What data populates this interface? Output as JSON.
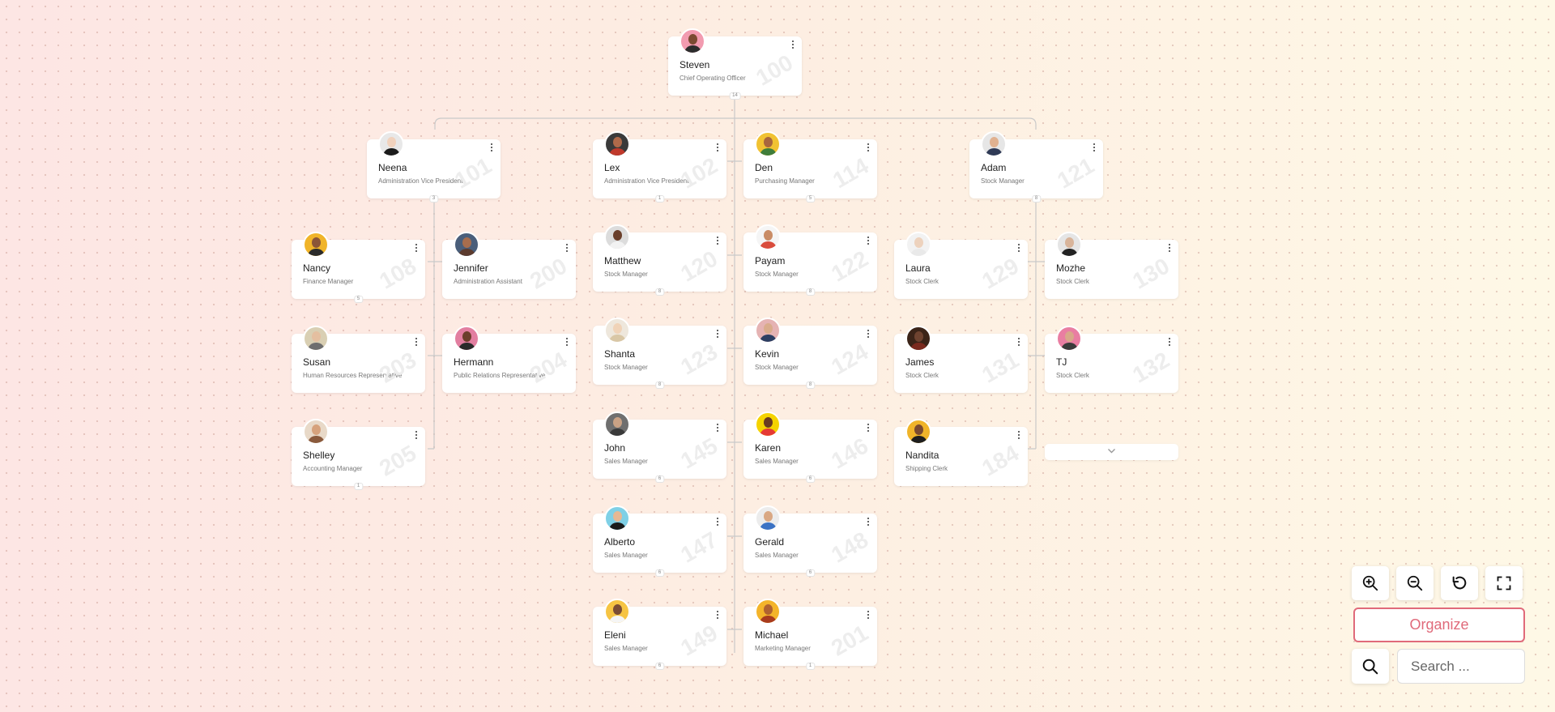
{
  "employees": [
    {
      "key": "steven",
      "name": "Steven",
      "title": "Chief Operating Officer",
      "id": "100",
      "badge": "14",
      "skin": "#7b4a32",
      "shirt": "#2c2c2c",
      "bg": "#f29bb0"
    },
    {
      "key": "neena",
      "name": "Neena",
      "title": "Administration Vice President",
      "id": "101",
      "badge": "3",
      "skin": "#f1d2bd",
      "shirt": "#1b1b1b",
      "bg": "#e8e8e8"
    },
    {
      "key": "lex",
      "name": "Lex",
      "title": "Administration Vice President",
      "id": "102",
      "badge": "1",
      "skin": "#b06a4a",
      "shirt": "#c0392b",
      "bg": "#3a3a3a"
    },
    {
      "key": "den",
      "name": "Den",
      "title": "Purchasing Manager",
      "id": "114",
      "badge": "5",
      "skin": "#a8663e",
      "shirt": "#3f7d3a",
      "bg": "#f1c232"
    },
    {
      "key": "adam",
      "name": "Adam",
      "title": "Stock Manager",
      "id": "121",
      "badge": "8",
      "skin": "#e0b190",
      "shirt": "#2f3a56",
      "bg": "#e6e6e6"
    },
    {
      "key": "nancy",
      "name": "Nancy",
      "title": "Finance Manager",
      "id": "108",
      "badge": "5",
      "skin": "#8a5538",
      "shirt": "#2b2b2b",
      "bg": "#f0b429"
    },
    {
      "key": "jennifer",
      "name": "Jennifer",
      "title": "Administration Assistant",
      "id": "200",
      "badge": "",
      "skin": "#a86d4d",
      "shirt": "#5c3b2e",
      "bg": "#4a5e7a"
    },
    {
      "key": "susan",
      "name": "Susan",
      "title": "Human Resources Representative",
      "id": "203",
      "badge": "",
      "skin": "#e4bfa0",
      "shirt": "#6e6e6e",
      "bg": "#d9cfb3"
    },
    {
      "key": "hermann",
      "name": "Hermann",
      "title": "Public Relations Representative",
      "id": "204",
      "badge": "",
      "skin": "#6b3e2a",
      "shirt": "#2a2a2a",
      "bg": "#e27ea0"
    },
    {
      "key": "shelley",
      "name": "Shelley",
      "title": "Accounting Manager",
      "id": "205",
      "badge": "1",
      "skin": "#d6a27c",
      "shirt": "#8a5a3c",
      "bg": "#e8d9c8"
    },
    {
      "key": "matthew",
      "name": "Matthew",
      "title": "Stock Manager",
      "id": "120",
      "badge": "8",
      "skin": "#6a3f2b",
      "shirt": "#f2f2f2",
      "bg": "#dcdcdc"
    },
    {
      "key": "payam",
      "name": "Payam",
      "title": "Stock Manager",
      "id": "122",
      "badge": "8",
      "skin": "#c98c66",
      "shirt": "#d94c3c",
      "bg": "#f5f5f5"
    },
    {
      "key": "laura",
      "name": "Laura",
      "title": "Stock Clerk",
      "id": "129",
      "badge": "",
      "skin": "#edd2bd",
      "shirt": "#e9e9e9",
      "bg": "#f2f2f2"
    },
    {
      "key": "mozhe",
      "name": "Mozhe",
      "title": "Stock Clerk",
      "id": "130",
      "badge": "",
      "skin": "#d8b49a",
      "shirt": "#222",
      "bg": "#e5e5e5"
    },
    {
      "key": "shanta",
      "name": "Shanta",
      "title": "Stock Manager",
      "id": "123",
      "badge": "8",
      "skin": "#f0d3b8",
      "shirt": "#d9c7a6",
      "bg": "#eee7dc"
    },
    {
      "key": "kevin",
      "name": "Kevin",
      "title": "Stock Manager",
      "id": "124",
      "badge": "8",
      "skin": "#d9ac8c",
      "shirt": "#2c3e62",
      "bg": "#e5b3b3"
    },
    {
      "key": "james",
      "name": "James",
      "title": "Stock Clerk",
      "id": "131",
      "badge": "",
      "skin": "#6e4330",
      "shirt": "#7a2a1e",
      "bg": "#3b2418"
    },
    {
      "key": "tj",
      "name": "TJ",
      "title": "Stock Clerk",
      "id": "132",
      "badge": "",
      "skin": "#d8a88a",
      "shirt": "#3b3b3b",
      "bg": "#e97ea2"
    },
    {
      "key": "john",
      "name": "John",
      "title": "Sales Manager",
      "id": "145",
      "badge": "6",
      "skin": "#caa285",
      "shirt": "#3a3a3a",
      "bg": "#6f6f6f"
    },
    {
      "key": "karen",
      "name": "Karen",
      "title": "Sales Manager",
      "id": "146",
      "badge": "6",
      "skin": "#6a3a22",
      "shirt": "#e53935",
      "bg": "#f5d300"
    },
    {
      "key": "nandita",
      "name": "Nandita",
      "title": "Shipping Clerk",
      "id": "184",
      "badge": "",
      "skin": "#7a4a30",
      "shirt": "#1e1e1e",
      "bg": "#f0b429"
    },
    {
      "key": "alberto",
      "name": "Alberto",
      "title": "Sales Manager",
      "id": "147",
      "badge": "6",
      "skin": "#e6b894",
      "shirt": "#1b1b1b",
      "bg": "#7fd0e6"
    },
    {
      "key": "gerald",
      "name": "Gerald",
      "title": "Sales Manager",
      "id": "148",
      "badge": "6",
      "skin": "#d9a884",
      "shirt": "#3a72c4",
      "bg": "#ececec"
    },
    {
      "key": "eleni",
      "name": "Eleni",
      "title": "Sales Manager",
      "id": "149",
      "badge": "6",
      "skin": "#7a4c34",
      "shirt": "#f5f5f5",
      "bg": "#f6c443"
    },
    {
      "key": "michael",
      "name": "Michael",
      "title": "Marketing Manager",
      "id": "201",
      "badge": "1",
      "skin": "#b06230",
      "shirt": "#a83b1e",
      "bg": "#f4b42a"
    }
  ],
  "controls": {
    "organize_label": "Organize",
    "search_placeholder": "Search ..."
  }
}
